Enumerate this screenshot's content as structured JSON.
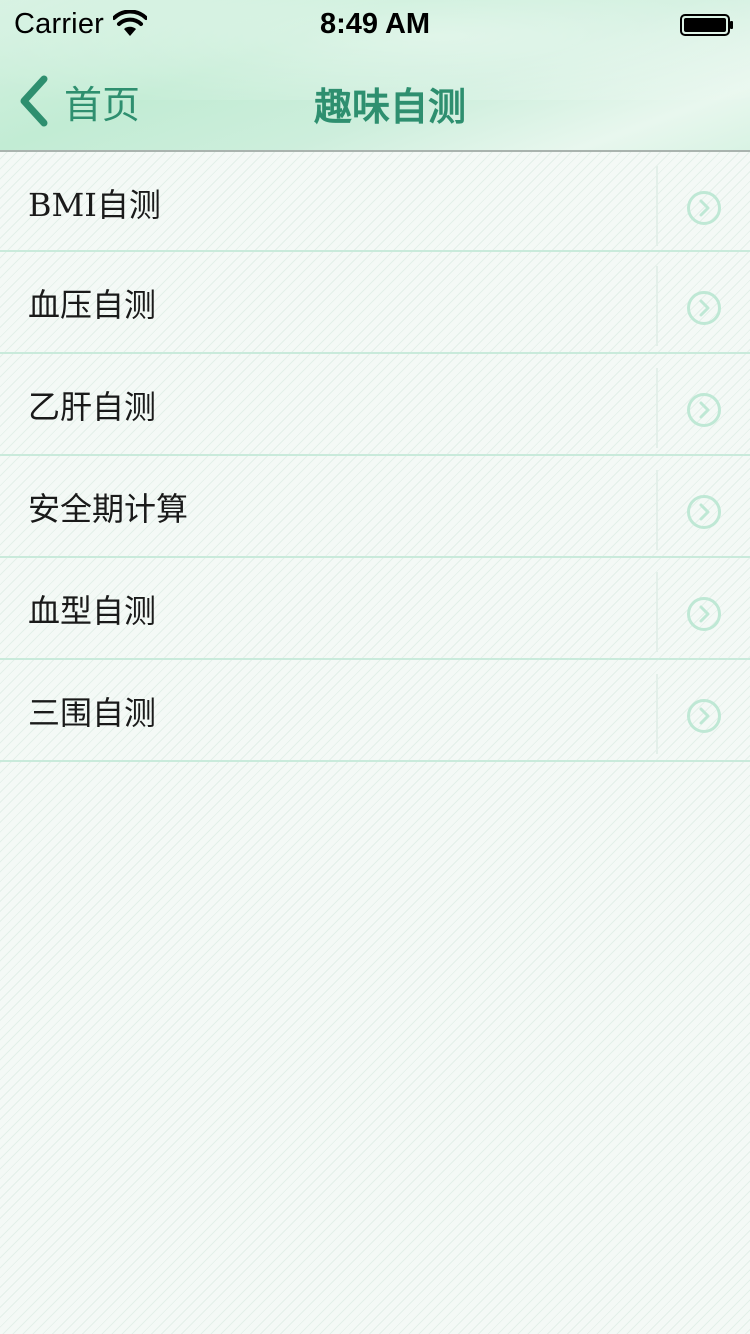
{
  "status_bar": {
    "carrier": "Carrier",
    "time": "8:49 AM",
    "wifi_icon": "wifi-icon",
    "battery_icon": "battery-icon"
  },
  "nav": {
    "back_label": "首页",
    "back_icon": "chevron-left-icon",
    "title": "趣味自测"
  },
  "list": {
    "items": [
      {
        "label": "BMI自测",
        "icon": "chevron-circle-right-icon"
      },
      {
        "label": "血压自测",
        "icon": "chevron-circle-right-icon"
      },
      {
        "label": "乙肝自测",
        "icon": "chevron-circle-right-icon"
      },
      {
        "label": "安全期计算",
        "icon": "chevron-circle-right-icon"
      },
      {
        "label": "血型自测",
        "icon": "chevron-circle-right-icon"
      },
      {
        "label": "三围自测",
        "icon": "chevron-circle-right-icon"
      }
    ]
  },
  "colors": {
    "accent": "#2e8f6f",
    "header_bg": "#c8eed9",
    "separator": "#c9eadb",
    "arrow": "#bfe8d5"
  }
}
